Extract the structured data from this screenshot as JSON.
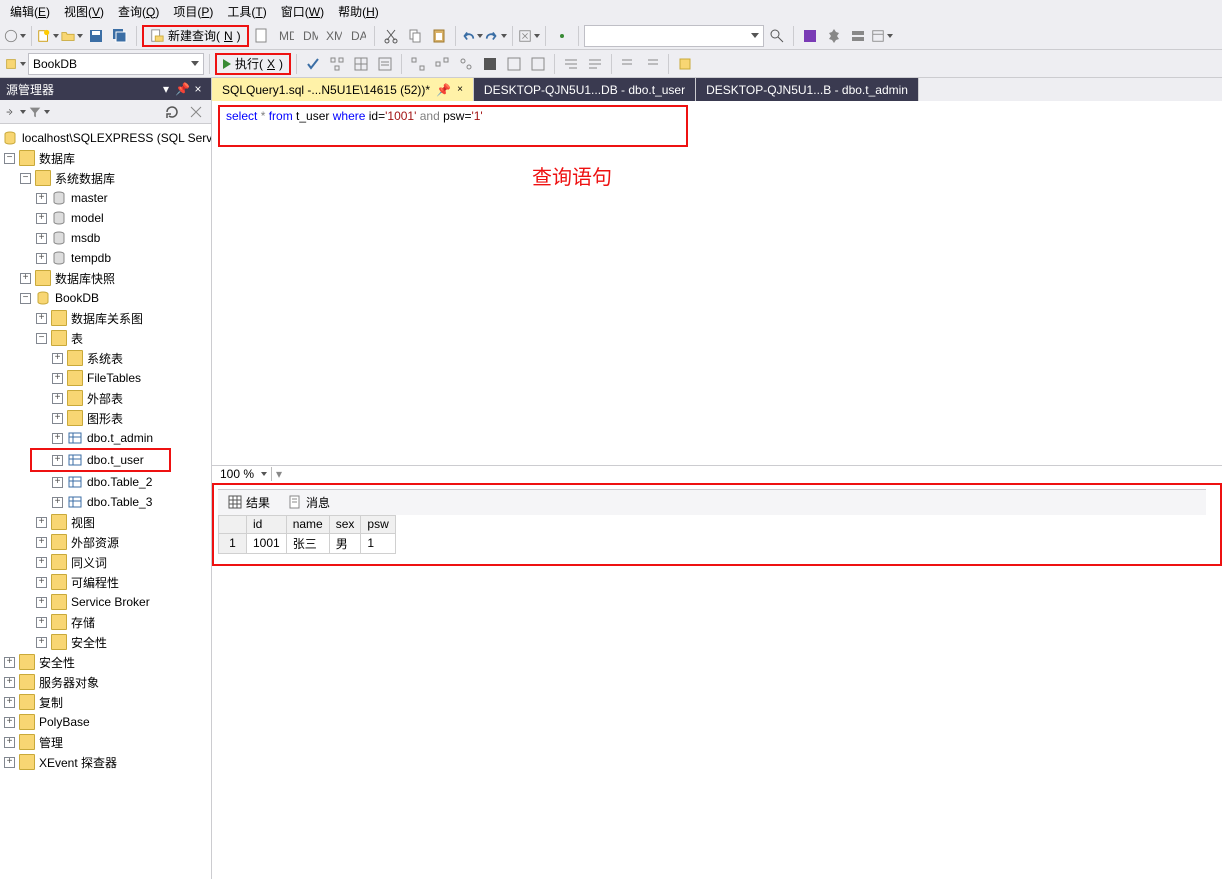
{
  "menu": {
    "edit": "编辑(",
    "edit_h": "E",
    "edit2": ")",
    "view": "视图(",
    "view_h": "V",
    "view2": ")",
    "query": "查询(",
    "query_h": "Q",
    "query2": ")",
    "project": "项目(",
    "project_h": "P",
    "project2": ")",
    "tools": "工具(",
    "tools_h": "T",
    "tools2": ")",
    "window": "窗口(",
    "window_h": "W",
    "window2": ")",
    "help": "帮助(",
    "help_h": "H",
    "help2": ")"
  },
  "toolbar": {
    "new_query": "新建查询(",
    "new_query_h": "N",
    "new_query2": ")",
    "db_combo": "BookDB",
    "exec": "执行(",
    "exec_h": "X",
    "exec2": ")",
    "find_combo": ""
  },
  "panel": {
    "title": "源管理器",
    "pin": "▾",
    "pin2": "📌",
    "close": "×"
  },
  "tree": {
    "root": "localhost\\SQLEXPRESS (SQL Server",
    "databases": "数据库",
    "sysdbs": "系统数据库",
    "master": "master",
    "model": "model",
    "msdb": "msdb",
    "tempdb": "tempdb",
    "snapshot": "数据库快照",
    "bookdb": "BookDB",
    "diagrams": "数据库关系图",
    "tables": "表",
    "systables": "系统表",
    "filetables": "FileTables",
    "exttables": "外部表",
    "graphtables": "图形表",
    "t_admin": "dbo.t_admin",
    "t_user": "dbo.t_user",
    "table2": "dbo.Table_2",
    "table3": "dbo.Table_3",
    "views": "视图",
    "extres": "外部资源",
    "synonyms": "同义词",
    "prog": "可编程性",
    "sbroker": "Service Broker",
    "storage": "存储",
    "security": "安全性",
    "security2": "安全性",
    "serverobj": "服务器对象",
    "repl": "复制",
    "polybase": "PolyBase",
    "mgmt": "管理",
    "xevent": "XEvent 探查器"
  },
  "tabs": {
    "t0": "SQLQuery1.sql -...N5U1E\\14615 (52))*",
    "t1": "DESKTOP-QJN5U1...DB - dbo.t_user",
    "t2": "DESKTOP-QJN5U1...B - dbo.t_admin"
  },
  "sql": {
    "kw_select": "select",
    "star": " * ",
    "kw_from": "from",
    "tbl": " t_user ",
    "kw_where": "where",
    "cond1a": " id=",
    "lit1": "'1001'",
    "spc": "  ",
    "kw_and": "and",
    "cond2a": " psw=",
    "lit2": "'1'"
  },
  "annotation": "查询语句",
  "zoom": "100 %",
  "results": {
    "tab_results": "结果",
    "tab_messages": "消息",
    "headers": {
      "c0": "",
      "c1": "id",
      "c2": "name",
      "c3": "sex",
      "c4": "psw"
    },
    "row": {
      "n": "1",
      "id": "1001",
      "name": "张三",
      "sex": "男",
      "psw": "1"
    }
  }
}
